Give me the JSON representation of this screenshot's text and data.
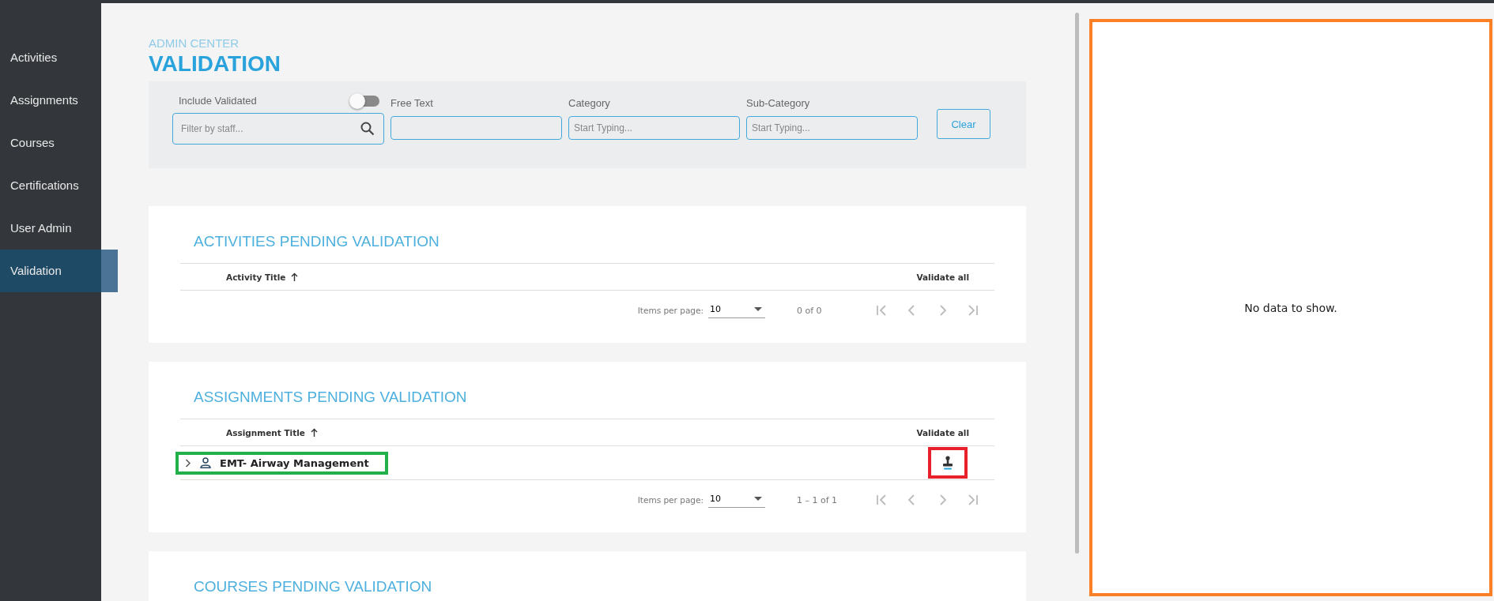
{
  "sidebar": {
    "items": [
      {
        "label": "Activities",
        "selected": false
      },
      {
        "label": "Assignments",
        "selected": false
      },
      {
        "label": "Courses",
        "selected": false
      },
      {
        "label": "Certifications",
        "selected": false
      },
      {
        "label": "User Admin",
        "selected": false
      },
      {
        "label": "Validation",
        "selected": true
      }
    ]
  },
  "header": {
    "breadcrumb": "ADMIN CENTER",
    "title": "VALIDATION"
  },
  "filters": {
    "include_validated": {
      "label": "Include Validated",
      "on": false
    },
    "staff_search": {
      "placeholder": "Filter by staff..."
    },
    "fields": [
      {
        "label": "Free Text"
      },
      {
        "label": "Category",
        "placeholder": "Start Typing..."
      },
      {
        "label": "Sub-Category",
        "placeholder": "Start Typing..."
      }
    ],
    "clear_button": "Clear"
  },
  "sections": [
    {
      "title": "ACTIVITIES PENDING VALIDATION",
      "columns": [
        "Activity Title",
        "Validate all"
      ],
      "pagination": {
        "label": "Items per page:",
        "page_size": "10",
        "range": "0 of 0",
        "nav_disabled": true
      }
    },
    {
      "title": "ASSIGNMENTS PENDING VALIDATION",
      "columns": [
        "Assignment Title",
        "Validate all"
      ],
      "rows": [
        {
          "title": "EMT- Airway Management",
          "expanded": false
        }
      ],
      "pagination": {
        "label": "Items per page:",
        "page_size": "10",
        "range": "1 – 1 of 1",
        "nav_disabled": true
      }
    },
    {
      "title": "COURSES PENDING VALIDATION"
    }
  ],
  "detail_panel": {
    "message": "No data to show."
  }
}
